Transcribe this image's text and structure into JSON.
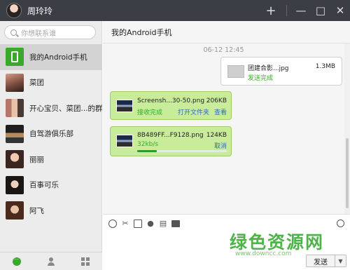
{
  "window": {
    "title": "周玲玲",
    "add_label": "+",
    "minimize_label": "—",
    "maximize_label": "□",
    "close_label": "✕"
  },
  "sidebar": {
    "search_placeholder": "你想联系谁",
    "contacts": [
      {
        "name": "我的Android手机",
        "avatar": "phone-icon",
        "active": true
      },
      {
        "name": "菜团"
      },
      {
        "name": "开心宝贝、菜团...的群聊"
      },
      {
        "name": "自驾游俱乐部"
      },
      {
        "name": "丽丽"
      },
      {
        "name": "百事可乐"
      },
      {
        "name": "阿飞"
      }
    ],
    "bottom_icons": [
      "chat-icon",
      "contacts-icon",
      "apps-icon"
    ]
  },
  "chat": {
    "header_title": "我的Android手机",
    "timestamp": "06-12 12:45",
    "messages": [
      {
        "direction": "out",
        "file_name": "团建合影...jpg",
        "file_size": "1.3MB",
        "status": "发送完成"
      },
      {
        "direction": "in",
        "file_name": "Screensh...30-50.png",
        "file_size": "206KB",
        "status": "接收完成",
        "action_open_folder": "打开文件夹",
        "action_view": "查看"
      },
      {
        "direction": "in",
        "file_name": "8B489FF...F9128.png",
        "file_size": "124KB",
        "speed": "32kb/s",
        "action_cancel": "取消",
        "progress": 0.22
      }
    ]
  },
  "toolbar": {
    "icons": [
      "emoji-icon",
      "screenshot-icon",
      "image-icon",
      "voice-icon",
      "file-icon",
      "folder-icon",
      "history-icon"
    ]
  },
  "input": {
    "send_label": "发送",
    "dropdown_label": "▼"
  },
  "watermark": {
    "text": "绿色资源网",
    "url": "www.downcc.com"
  },
  "colors": {
    "accent_green": "#3aa82a",
    "link_blue": "#2b6fb5",
    "bubble_green": "#c9ec9a",
    "titlebar": "#3b3f45"
  }
}
